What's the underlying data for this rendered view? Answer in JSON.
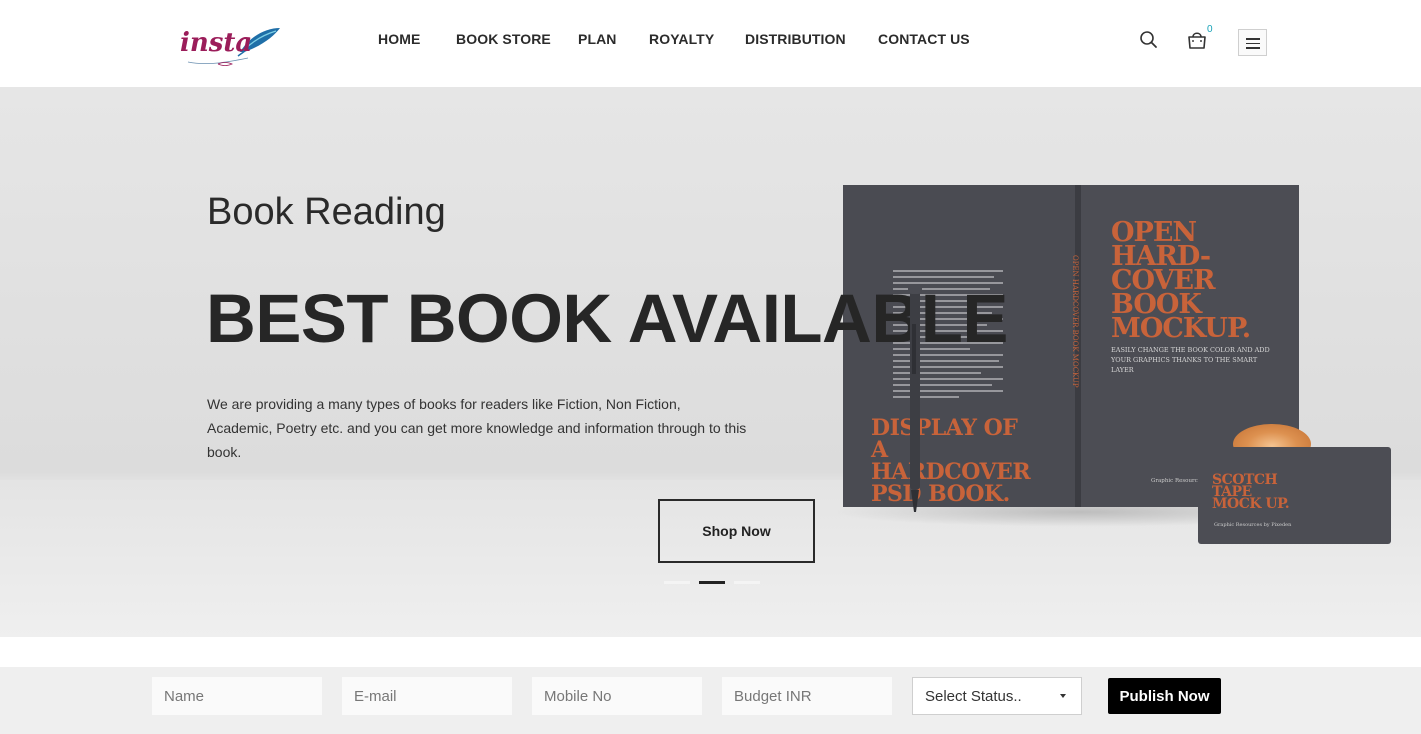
{
  "header": {
    "logo_text": "insta",
    "nav": [
      {
        "label": "HOME"
      },
      {
        "label": "BOOK STORE"
      },
      {
        "label": "PLAN"
      },
      {
        "label": "ROYALTY"
      },
      {
        "label": "DISTRIBUTION"
      },
      {
        "label": "CONTACT US"
      }
    ],
    "cart_count": "0",
    "icons": {
      "search": "search-icon",
      "cart": "cart-icon",
      "menu": "hamburger-icon"
    },
    "logo_color": "#9b1d5a",
    "accent_color": "#17a2b8"
  },
  "hero": {
    "subtitle": "Book Reading",
    "title": "BEST BOOK AVAILABLE",
    "description": "We are providing a many types of books for readers like Fiction, Non Fiction, Academic, Poetry etc. and you can get more knowledge and information through to this book.",
    "cta_label": "Shop Now",
    "slides_count": 3,
    "active_slide": 2,
    "mockup": {
      "left_title": "DISPLAY OF A HARDCOVER PSD BOOK.",
      "right_title": "OPEN HARD-COVER BOOK MOCKUP.",
      "right_subtitle": "EASILY CHANGE THE BOOK COLOR AND ADD YOUR GRAPHICS THANKS TO THE SMART LAYER",
      "spine_text": "OPEN HARDCOVER BOOK MOCKUP",
      "credit": "Graphic Resources",
      "tape_title": "SCOTCH TAPE MOCK UP.",
      "tape_credit": "Graphic Resources by Pixeden",
      "accent_color": "#c8633a"
    }
  },
  "form": {
    "name_placeholder": "Name",
    "email_placeholder": "E-mail",
    "mobile_placeholder": "Mobile No",
    "budget_placeholder": "Budget INR",
    "status_selected": "Select Status..",
    "submit_label": "Publish Now"
  }
}
